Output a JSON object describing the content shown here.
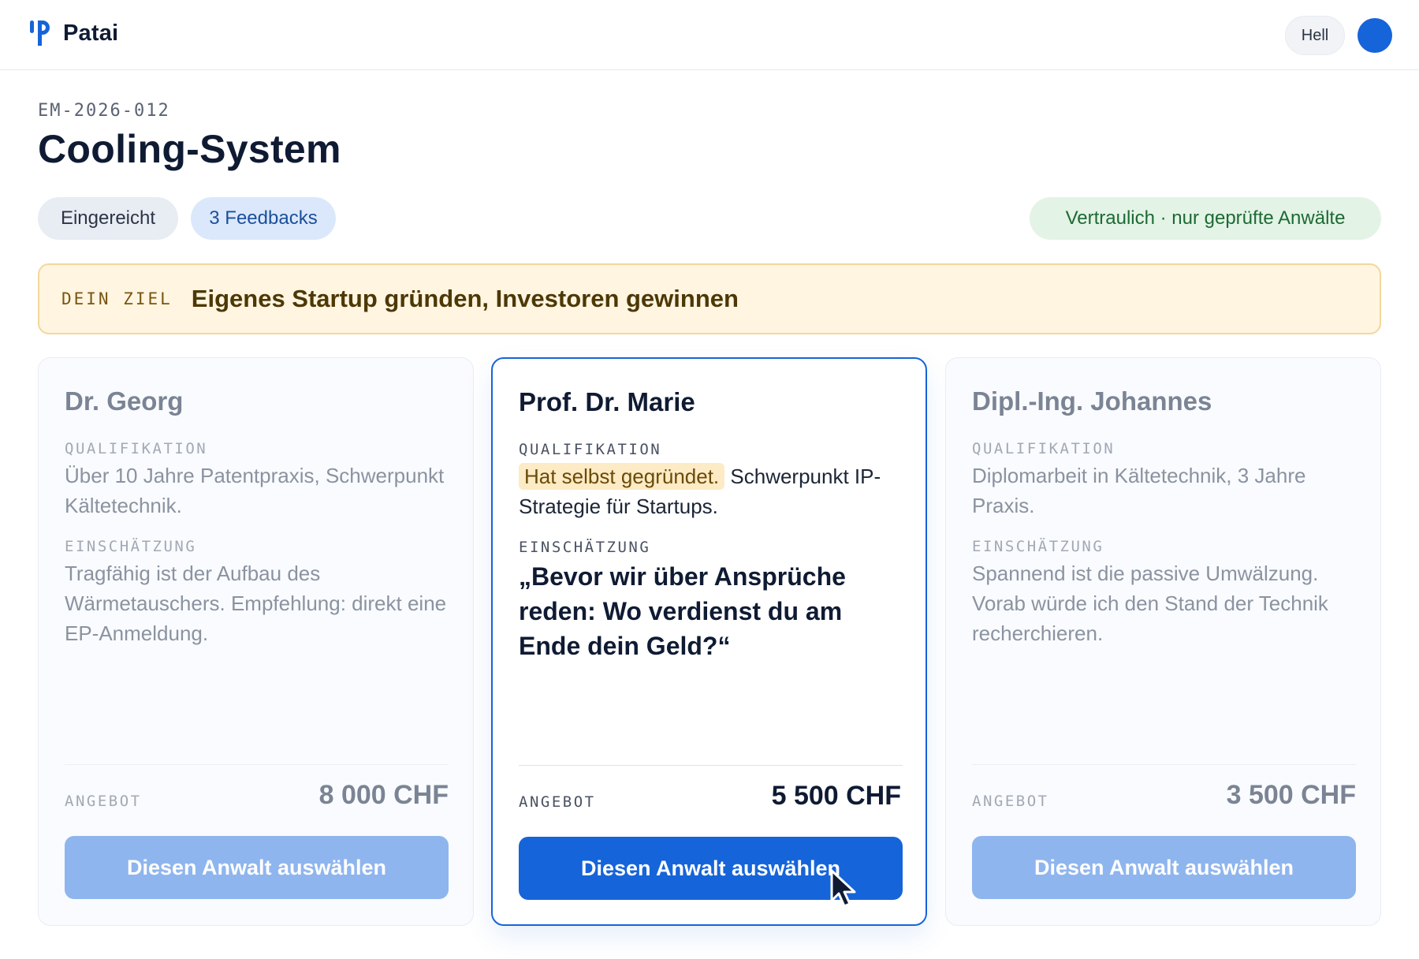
{
  "app": {
    "name": "Patai",
    "logo_icon": "patai-logo-icon"
  },
  "header": {
    "theme_toggle_label": "Hell"
  },
  "case": {
    "id": "EM-2026-012",
    "title": "Cooling-System",
    "status": "Eingereicht",
    "feedback_count_label": "3 Feedbacks",
    "confidential_label": "Vertraulich · nur geprüfte Anwälte"
  },
  "goal": {
    "label": "DEIN ZIEL",
    "text": "Eigenes Startup gründen, Investoren gewinnen"
  },
  "labels": {
    "qualification": "QUALIFIKATION",
    "assessment": "EINSCHÄTZUNG",
    "offer": "ANGEBOT",
    "select_button": "Diesen Anwalt auswählen"
  },
  "lawyers": [
    {
      "name": "Dr. Georg",
      "qualification": "Über 10 Jahre Patentpraxis, Schwerpunkt Kältetechnik.",
      "assessment": "Tragfähig ist der Aufbau des Wärmetauschers. Empfehlung: direkt eine EP-Anmeldung.",
      "offer": "8 000 CHF",
      "selected": false
    },
    {
      "name": "Prof. Dr. Marie",
      "qualification_highlight": "Hat selbst gegründet.",
      "qualification_rest": "Schwerpunkt IP-Strategie für Startups.",
      "assessment_quote": "„Bevor wir über Ansprüche reden: Wo verdienst du am Ende dein Geld?“",
      "offer": "5 500 CHF",
      "selected": true
    },
    {
      "name": "Dipl.-Ing. Johannes",
      "qualification": "Diplomarbeit in Kältetechnik, 3 Jahre Praxis.",
      "assessment": "Spannend ist die passive Umwälzung. Vorab würde ich den Stand der Technik recherchieren.",
      "offer": "3 500 CHF",
      "selected": false
    }
  ],
  "colors": {
    "primary": "#1664d9",
    "primary_disabled": "#8fb5ee",
    "goal_bg": "#fff5e1",
    "goal_border": "#f3d79b",
    "confidential_bg": "#e3f3e6",
    "highlight_bg": "#fdebc5"
  }
}
